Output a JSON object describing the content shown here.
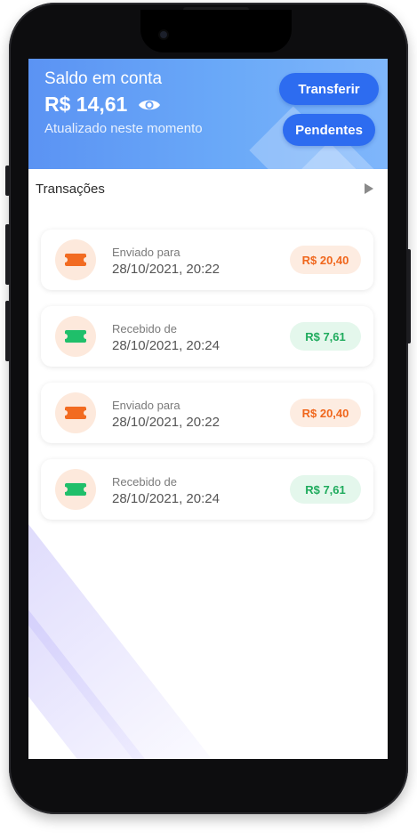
{
  "header": {
    "balance_label": "Saldo em conta",
    "balance_value": "R$ 14,61",
    "updated_text": "Atualizado neste momento",
    "transfer_button": "Transferir",
    "pending_button": "Pendentes"
  },
  "transactions": {
    "title": "Transações",
    "items": [
      {
        "type": "sent",
        "label": "Enviado para",
        "date": "28/10/2021, 20:22",
        "amount": "R$ 20,40"
      },
      {
        "type": "received",
        "label": "Recebido de",
        "date": "28/10/2021, 20:24",
        "amount": "R$ 7,61"
      },
      {
        "type": "sent",
        "label": "Enviado para",
        "date": "28/10/2021, 20:22",
        "amount": "R$ 20,40"
      },
      {
        "type": "received",
        "label": "Recebido de",
        "date": "28/10/2021, 20:24",
        "amount": "R$ 7,61"
      }
    ]
  },
  "icons": {
    "visibility": "eye-icon",
    "sent": "ticket-icon",
    "received": "ticket-icon",
    "expand": "triangle-right-icon"
  },
  "colors": {
    "header_gradient_start": "#5b93f3",
    "button_blue": "#2d6cf0",
    "sent_accent": "#f26b21",
    "received_accent": "#1fbf6a"
  }
}
